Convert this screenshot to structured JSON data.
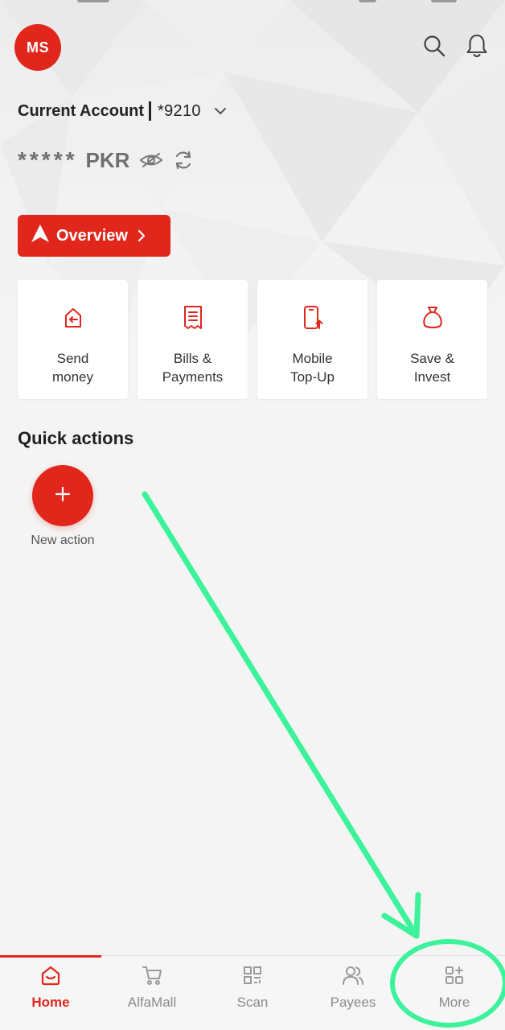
{
  "theme": {
    "accent": "#e1261c",
    "annotation_color": "#3cf29a",
    "muted_text": "#8a8a8a"
  },
  "header": {
    "avatar_initials": "MS",
    "icons": [
      "search-icon",
      "bell-icon"
    ]
  },
  "account": {
    "name": "Current Account",
    "number": "*9210",
    "balance_mask": "*****",
    "currency": "PKR"
  },
  "overview_button": {
    "label": "Overview"
  },
  "services": [
    {
      "label": "Send\nmoney",
      "icon": "send-money-icon"
    },
    {
      "label": "Bills &\nPayments",
      "icon": "receipt-icon"
    },
    {
      "label": "Mobile\nTop-Up",
      "icon": "mobile-topup-icon"
    },
    {
      "label": "Save &\nInvest",
      "icon": "money-bag-icon"
    }
  ],
  "quick_actions": {
    "title": "Quick actions",
    "new_action_label": "New action"
  },
  "bottom_nav": {
    "active": "Home",
    "items": [
      {
        "label": "Home",
        "icon": "home-icon"
      },
      {
        "label": "AlfaMall",
        "icon": "cart-icon"
      },
      {
        "label": "Scan",
        "icon": "qr-scan-icon"
      },
      {
        "label": "Payees",
        "icon": "people-icon"
      },
      {
        "label": "More",
        "icon": "grid-plus-icon"
      }
    ]
  }
}
